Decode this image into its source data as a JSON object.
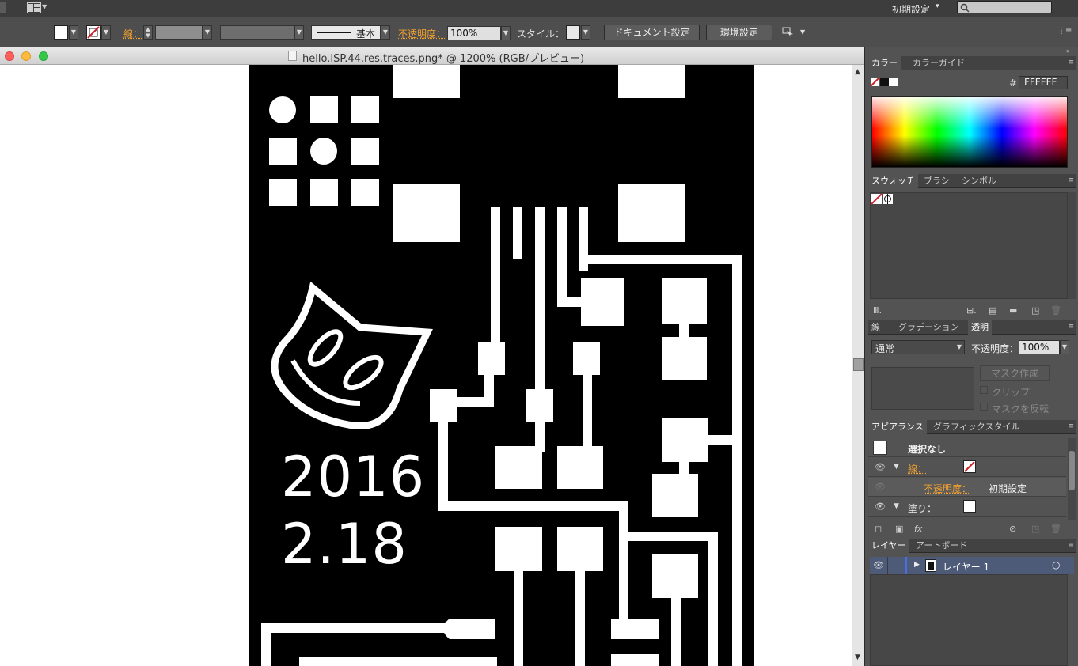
{
  "toolbar": {
    "workspace_label": "初期設定",
    "workspace_caret": "▾",
    "search_placeholder": "",
    "stroke_label": "線：",
    "brush_label": "基本",
    "opacity_label": "不透明度：",
    "opacity_value": "100%",
    "style_label": "スタイル：",
    "doc_settings_button": "ドキュメント設定",
    "prefs_button": "環境設定"
  },
  "document": {
    "title": "hello.ISP.44.res.traces.png* @ 1200% (RGB/プレビュー)",
    "art_text_year": "2016",
    "art_text_date": "2.18"
  },
  "panels": {
    "color": {
      "tab_color": "カラー",
      "tab_color_guide": "カラーガイド",
      "hash": "#",
      "hex_value": "FFFFFF"
    },
    "swatches": {
      "tab_swatches": "スウォッチ",
      "tab_brushes": "ブラシ",
      "tab_symbols": "シンボル"
    },
    "transparency": {
      "tab_stroke": "線",
      "tab_gradient": "グラデーション",
      "tab_transparency": "透明",
      "blend_mode": "通常",
      "opacity_label": "不透明度：",
      "opacity_value": "100%",
      "make_mask_button": "マスク作成",
      "clip_label": "クリップ",
      "invert_mask_label": "マスクを反転"
    },
    "appearance": {
      "tab_appearance": "アピアランス",
      "tab_graphic_styles": "グラフィックスタイル",
      "no_selection": "選択なし",
      "stroke_label": "線：",
      "opacity_label": "不透明度：",
      "opacity_value": "初期設定",
      "fill_label": "塗り：",
      "fx_label": "fx"
    },
    "layers": {
      "tab_layers": "レイヤー",
      "tab_artboards": "アートボード",
      "layer_name": "レイヤー 1"
    }
  },
  "colors": {
    "accent_orange": "#f0a030",
    "panel_bg": "#535353",
    "layer_highlight": "#4d5a78",
    "layer_color_bar": "#4a6ee0"
  }
}
